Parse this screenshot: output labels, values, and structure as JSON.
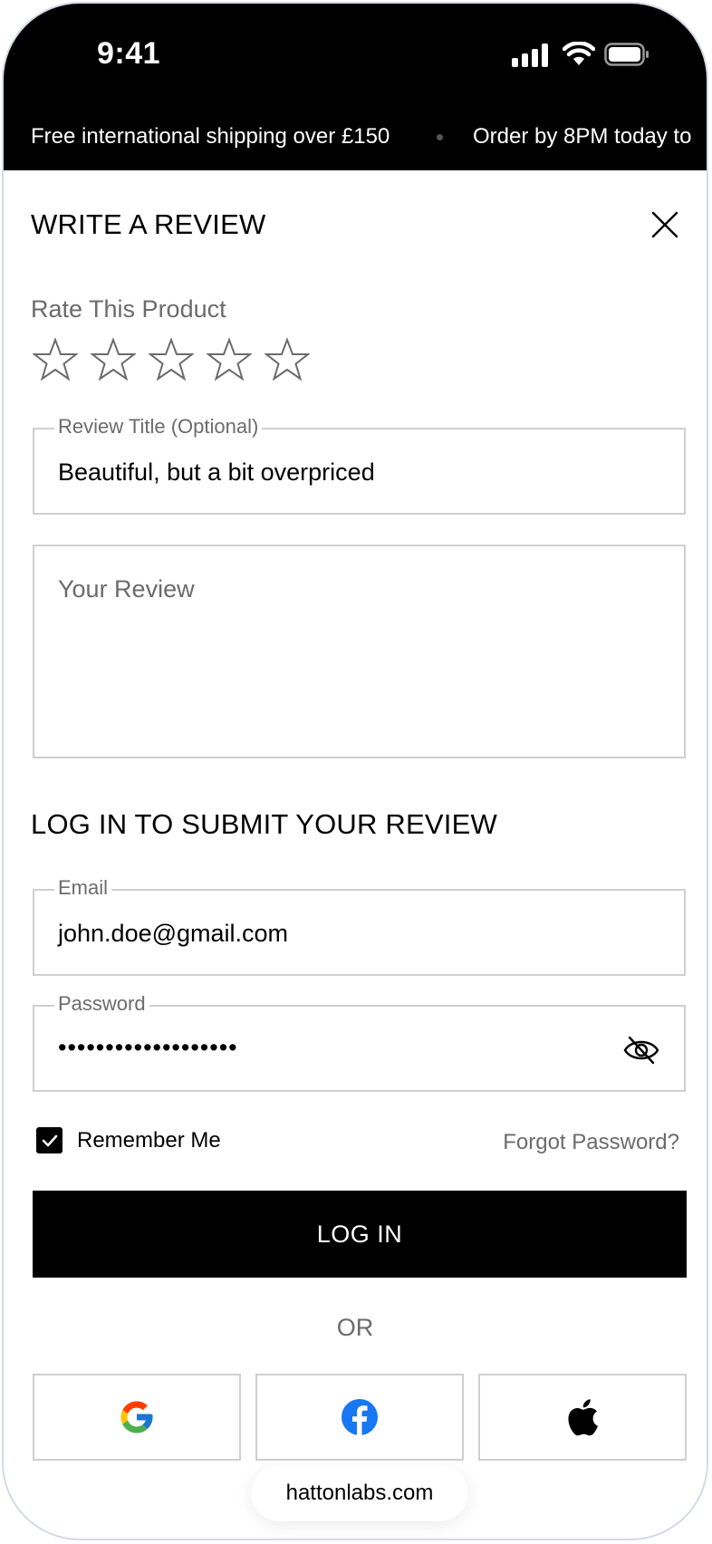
{
  "status_bar": {
    "time": "9:41"
  },
  "announcement": {
    "message_1": "Free international shipping over £150",
    "message_2": "Order by 8PM today to"
  },
  "review": {
    "title": "WRITE A REVIEW",
    "rate_label": "Rate This Product",
    "rating": 0,
    "rating_max": 5,
    "review_title_label": "Review Title (Optional)",
    "review_title_value": "Beautiful, but a bit overpriced",
    "review_body_placeholder": "Your Review"
  },
  "login": {
    "heading": "LOG IN TO SUBMIT YOUR REVIEW",
    "email_label": "Email",
    "email_value": "john.doe@gmail.com",
    "password_label": "Password",
    "password_masked": "•••••••••••••••••••",
    "remember_label": "Remember Me",
    "remember_checked": true,
    "forgot_label": "Forgot Password?",
    "login_button": "LOG IN",
    "or_label": "OR",
    "social_buttons": [
      "google-icon",
      "facebook-icon",
      "apple-icon"
    ]
  },
  "browser": {
    "url": "hattonlabs.com"
  },
  "colors": {
    "background": "#ffffff",
    "header_black": "#000000",
    "border": "#cfcfcf",
    "muted_text": "#6b6b6b",
    "facebook_blue": "#1877f2"
  }
}
